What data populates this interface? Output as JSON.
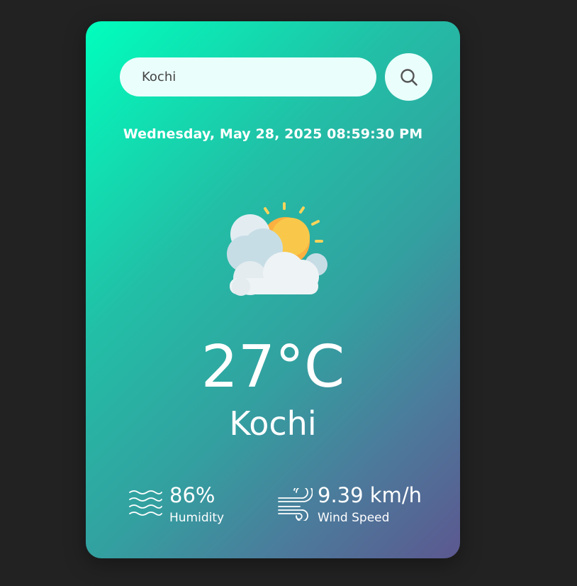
{
  "search": {
    "value": "Kochi",
    "icon": "search-icon"
  },
  "datetime": "Wednesday, May 28, 2025 08:59:30 PM",
  "weather": {
    "icon": "partly-cloudy-icon",
    "temperature": "27°C",
    "city": "Kochi"
  },
  "stats": {
    "humidity": {
      "value": "86%",
      "label": "Humidity",
      "icon": "humidity-waves-icon"
    },
    "wind": {
      "value": "9.39 km/h",
      "label": "Wind Speed",
      "icon": "wind-icon"
    }
  },
  "colors": {
    "background": "#222223",
    "gradient_start": "#00ffbd",
    "gradient_end": "#5c5890",
    "search_bg": "#eafffb"
  }
}
